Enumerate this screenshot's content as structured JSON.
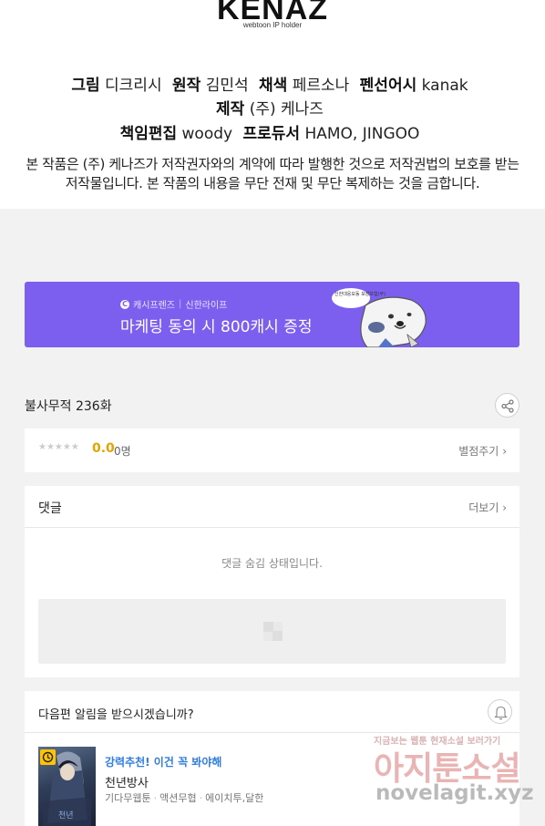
{
  "credits": {
    "logo": "KENAZ",
    "logo_sub": "webtoon IP holder",
    "line1": [
      {
        "role": "그림",
        "name": "디크리시"
      },
      {
        "role": "원작",
        "name": "김민석"
      },
      {
        "role": "채색",
        "name": "페르소나"
      },
      {
        "role": "펜선어시",
        "name": "kanak"
      }
    ],
    "line2": [
      {
        "role": "제작",
        "name": "(주) 케나즈"
      }
    ],
    "line3": [
      {
        "role": "책임편집",
        "name": "woody"
      },
      {
        "role": "프로듀서",
        "name": "HAMO, JINGOO"
      }
    ],
    "notice": "본 작품은 (주) 케나즈가 저작권자와의 계약에 따라 발행한 것으로 저작권법의 보호를 받는 저작물입니다. 본 작품의 내용을 무단 전재 및 무단 복제하는 것을 금합니다."
  },
  "banner": {
    "brand": "캐시프렌즈",
    "partner": "신한라이프",
    "title": "마케팅 동의 시 800캐시 증정",
    "bubble": "신한대응모동 보장보험(무)",
    "bg_color": "#7d5fef"
  },
  "episode": {
    "title": "불사무적 236화",
    "share_icon": "share-icon"
  },
  "rating": {
    "stars": "★★★★★",
    "score": "0.0",
    "count": "0명",
    "link": "별점주기"
  },
  "comments": {
    "title": "댓글",
    "more": "더보기",
    "hidden_text": "댓글 숨김 상태입니다."
  },
  "next_alert": {
    "question": "다음편 알림을 받으시겠습니까?",
    "bell_icon": "bell-icon"
  },
  "recommend": {
    "tag": "강력추천! 이건 꼭 봐야해",
    "name": "천년방사",
    "meta": [
      "기다무웹툰",
      "액션무협",
      "에이치투,달한"
    ]
  },
  "watermark": {
    "top": "지금보는 웹툰 현재소설 보러가기",
    "main": "아지툰소설",
    "url": "novelagit.xyz"
  }
}
